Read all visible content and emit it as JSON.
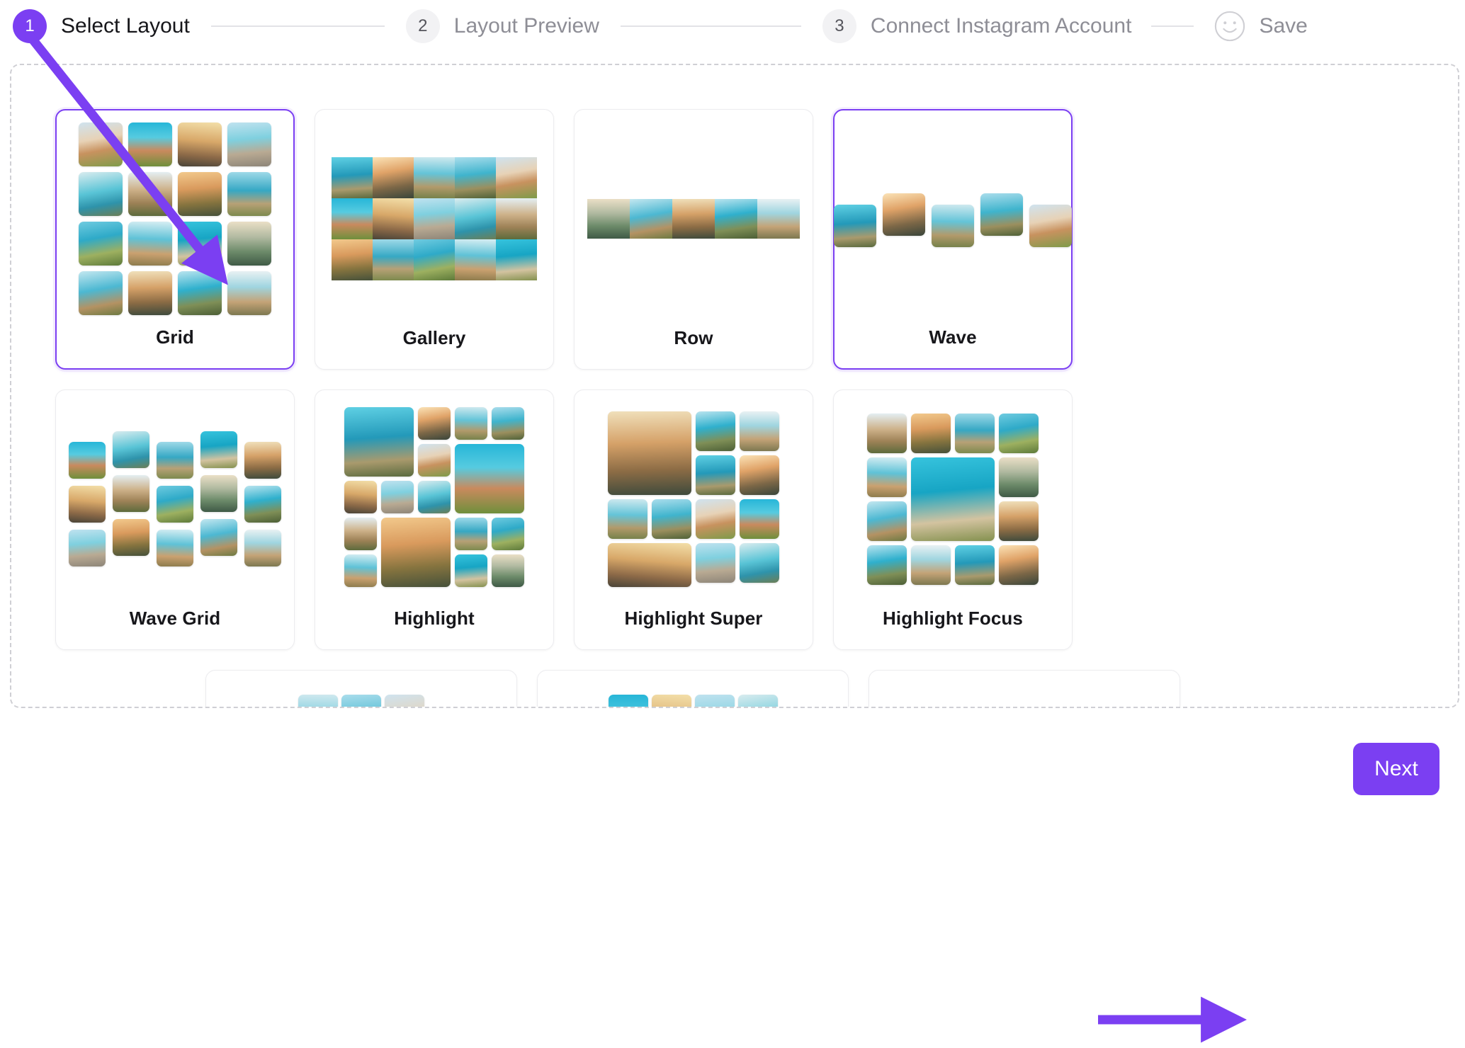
{
  "accent_color": "#7B3FF2",
  "stepper": {
    "steps": [
      {
        "number": "1",
        "label": "Select Layout",
        "state": "active"
      },
      {
        "number": "2",
        "label": "Layout Preview",
        "state": "inactive"
      },
      {
        "number": "3",
        "label": "Connect Instagram Account",
        "state": "inactive"
      },
      {
        "number": "",
        "label": "Save",
        "state": "inactive",
        "icon": "smiley-icon"
      }
    ]
  },
  "layouts": {
    "row1": [
      {
        "label": "Grid",
        "selected": true,
        "preview": "grid-4x4"
      },
      {
        "label": "Gallery",
        "selected": false,
        "preview": "gallery-5x3"
      },
      {
        "label": "Row",
        "selected": false,
        "preview": "row-strip"
      },
      {
        "label": "Wave",
        "selected": true,
        "preview": "wave-5"
      }
    ],
    "row2": [
      {
        "label": "Wave Grid",
        "selected": false,
        "preview": "wave-grid-5x3"
      },
      {
        "label": "Highlight",
        "selected": false,
        "preview": "mosaic-highlight"
      },
      {
        "label": "Highlight Super",
        "selected": false,
        "preview": "mosaic-highlight-super"
      },
      {
        "label": "Highlight Focus",
        "selected": false,
        "preview": "mosaic-highlight-focus"
      }
    ],
    "row3_cutoff": [
      {
        "label": "",
        "selected": false,
        "preview": "vstrip-3"
      },
      {
        "label": "",
        "selected": false,
        "preview": "vstrip-4"
      },
      {
        "label": "",
        "selected": false,
        "preview": "empty"
      }
    ]
  },
  "footer": {
    "next_label": "Next"
  },
  "annotations": {
    "arrow_to_grid": "purple arrow pointing from step 1 to the Grid layout card",
    "arrow_to_next": "purple arrow pointing right toward the Next button"
  }
}
